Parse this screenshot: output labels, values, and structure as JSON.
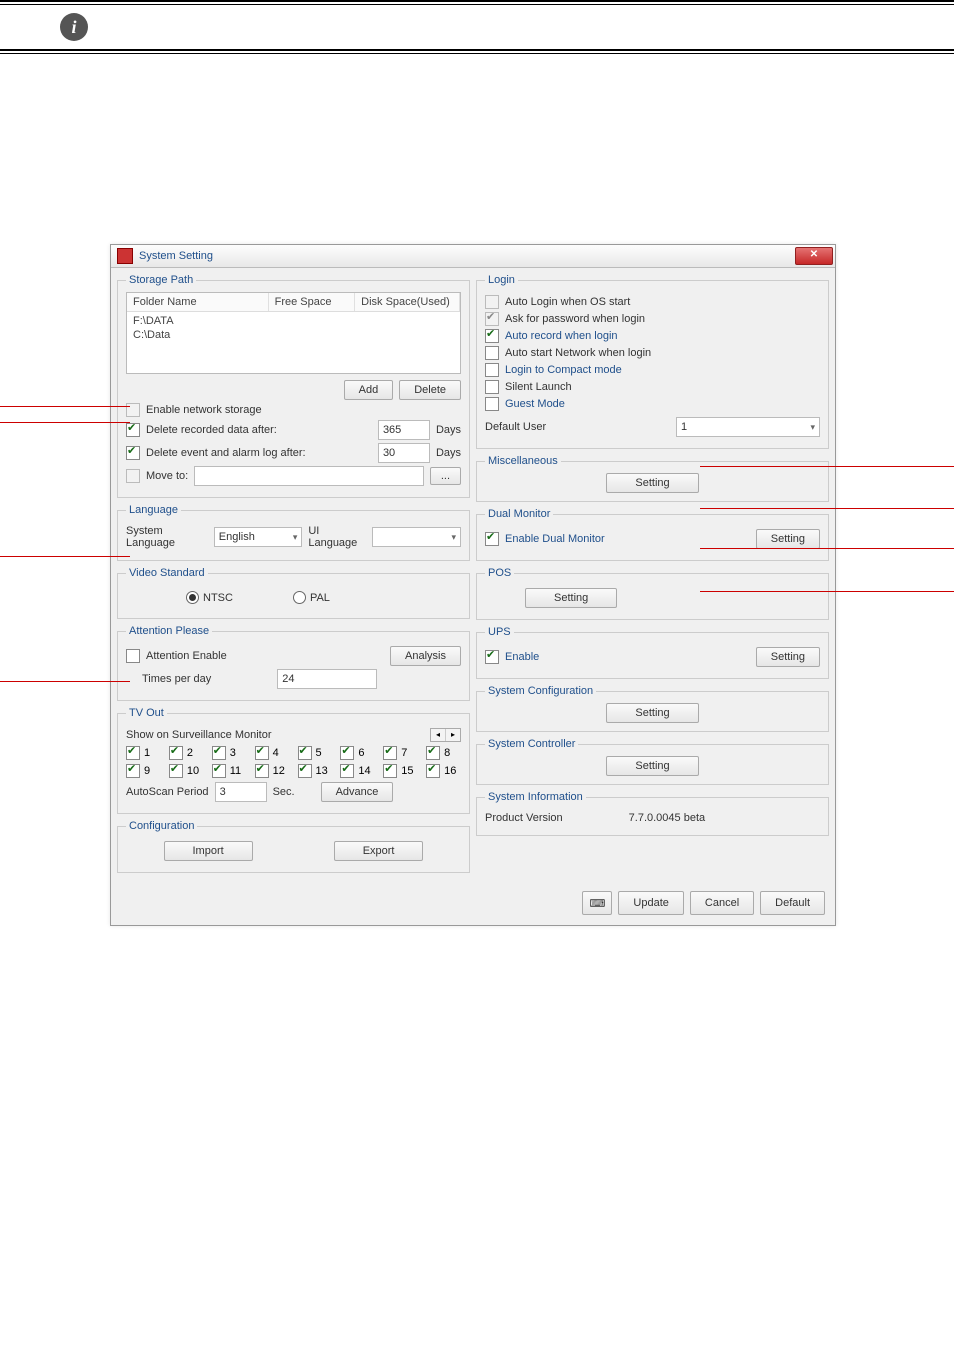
{
  "window": {
    "title": "System Setting"
  },
  "storage": {
    "legend": "Storage Path",
    "cols": {
      "folder": "Folder Name",
      "free": "Free Space",
      "used": "Disk Space(Used)"
    },
    "rows": [
      "F:\\DATA",
      "C:\\Data"
    ],
    "add": "Add",
    "delete": "Delete",
    "enable_net": "Enable network storage",
    "del_rec": "Delete recorded data after:",
    "del_rec_val": "365",
    "del_rec_unit": "Days",
    "del_log": "Delete event and alarm log after:",
    "del_log_val": "30",
    "del_log_unit": "Days",
    "move_to": "Move to:",
    "browse": "..."
  },
  "language": {
    "legend": "Language",
    "sys": "System Language",
    "sys_val": "English",
    "ui": "UI Language",
    "ui_val": ""
  },
  "video": {
    "legend": "Video Standard",
    "ntsc": "NTSC",
    "pal": "PAL"
  },
  "attention": {
    "legend": "Attention Please",
    "enable": "Attention Enable",
    "analysis": "Analysis",
    "times": "Times per day",
    "times_val": "24"
  },
  "tvout": {
    "legend": "TV Out",
    "show": "Show on Surveillance Monitor",
    "channels": [
      "1",
      "2",
      "3",
      "4",
      "5",
      "6",
      "7",
      "8",
      "9",
      "10",
      "11",
      "12",
      "13",
      "14",
      "15",
      "16"
    ],
    "autoscan": "AutoScan Period",
    "autoscan_val": "3",
    "sec": "Sec.",
    "advance": "Advance"
  },
  "config": {
    "legend": "Configuration",
    "import": "Import",
    "export": "Export"
  },
  "login": {
    "legend": "Login",
    "auto_login": "Auto Login when OS start",
    "ask_pw": "Ask for password when login",
    "auto_record": "Auto record when login",
    "auto_net": "Auto start Network when login",
    "compact": "Login to Compact mode",
    "silent": "Silent Launch",
    "guest": "Guest Mode",
    "default_user": "Default User",
    "default_user_val": "1"
  },
  "misc": {
    "legend": "Miscellaneous",
    "setting": "Setting"
  },
  "dual": {
    "legend": "Dual Monitor",
    "enable": "Enable Dual Monitor",
    "setting": "Setting"
  },
  "pos": {
    "legend": "POS",
    "setting": "Setting"
  },
  "ups": {
    "legend": "UPS",
    "enable": "Enable",
    "setting": "Setting"
  },
  "sysconf": {
    "legend": "System Configuration",
    "setting": "Setting"
  },
  "sysctrl": {
    "legend": "System Controller",
    "setting": "Setting"
  },
  "sysinfo": {
    "legend": "System Information",
    "pv": "Product Version",
    "pv_val": "7.7.0.0045 beta"
  },
  "footer": {
    "update": "Update",
    "cancel": "Cancel",
    "default": "Default"
  }
}
